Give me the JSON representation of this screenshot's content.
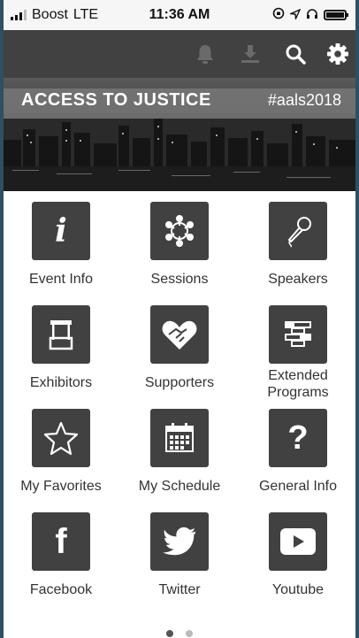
{
  "status_bar": {
    "carrier": "Boost",
    "network": "LTE",
    "time": "11:36 AM"
  },
  "toolbar": {
    "icons": [
      "bell-icon",
      "download-icon",
      "search-icon",
      "gear-icon"
    ]
  },
  "banner": {
    "title": "ACCESS TO JUSTICE",
    "hashtag": "#aals2018"
  },
  "menu": {
    "tiles": [
      {
        "label": "Event Info",
        "icon": "info-icon"
      },
      {
        "label": "Sessions",
        "icon": "network-icon"
      },
      {
        "label": "Speakers",
        "icon": "microphone-icon"
      },
      {
        "label": "Exhibitors",
        "icon": "booth-icon"
      },
      {
        "label": "Supporters",
        "icon": "handshake-heart-icon"
      },
      {
        "label": "Extended Programs",
        "icon": "blocks-icon"
      },
      {
        "label": "My Favorites",
        "icon": "star-icon"
      },
      {
        "label": "My Schedule",
        "icon": "calendar-icon"
      },
      {
        "label": "General Info",
        "icon": "question-icon"
      },
      {
        "label": "Facebook",
        "icon": "facebook-icon"
      },
      {
        "label": "Twitter",
        "icon": "twitter-icon"
      },
      {
        "label": "Youtube",
        "icon": "youtube-icon"
      }
    ]
  },
  "pager": {
    "pages": 2,
    "current": 1
  },
  "colors": {
    "toolbar": "#414141",
    "tile": "#414141",
    "frame": "#2f4f63"
  }
}
